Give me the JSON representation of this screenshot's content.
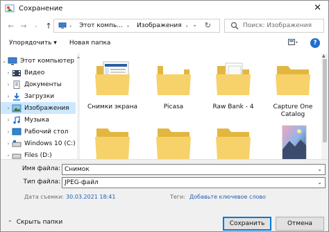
{
  "window": {
    "title": "Сохранение",
    "close": "✕"
  },
  "nav": {
    "address": [
      "Этот компь...",
      "Изображения"
    ],
    "search_placeholder": "Поиск: Изображения"
  },
  "toolbar": {
    "organize": "Упорядочить ▾",
    "new_folder": "Новая папка"
  },
  "sidebar": {
    "items": [
      {
        "label": "Этот компьютер",
        "icon": "computer-icon",
        "expand": "⌄"
      },
      {
        "label": "Видео",
        "icon": "video-folder-icon",
        "expand": "›"
      },
      {
        "label": "Документы",
        "icon": "documents-folder-icon",
        "expand": "›"
      },
      {
        "label": "Загрузки",
        "icon": "downloads-folder-icon",
        "expand": "›"
      },
      {
        "label": "Изображения",
        "icon": "pictures-folder-icon",
        "expand": "›",
        "selected": true
      },
      {
        "label": "Музыка",
        "icon": "music-folder-icon",
        "expand": "›"
      },
      {
        "label": "Рабочий стол",
        "icon": "desktop-folder-icon",
        "expand": "›"
      },
      {
        "label": "Windows 10 (C:)",
        "icon": "drive-icon",
        "expand": "›"
      },
      {
        "label": "Files (D:)",
        "icon": "drive-icon",
        "expand": "›"
      }
    ]
  },
  "folders": [
    {
      "label": "Снимки экрана",
      "icon": "screenshots-folder-icon"
    },
    {
      "label": "Picasa",
      "icon": "folder-icon"
    },
    {
      "label": "Raw Bank - 4",
      "icon": "folder-icon"
    },
    {
      "label": "Capture One Catalog",
      "icon": "folder-icon"
    },
    {
      "label": "",
      "icon": "folder-icon"
    },
    {
      "label": "",
      "icon": "folder-icon"
    },
    {
      "label": "",
      "icon": "folder-icon"
    },
    {
      "label": "",
      "icon": "image-thumbnail-icon"
    }
  ],
  "form": {
    "filename_label": "Имя файла:",
    "filename_value": "Снимок",
    "filetype_label": "Тип файла:",
    "filetype_value": "JPEG-файл",
    "date_label": "Дата съемки:",
    "date_value": "30.03.2021 18:41",
    "tags_label": "Теги:",
    "tags_value": "Добавьте ключевое слово"
  },
  "footer": {
    "hide_folders": "Скрыть папки",
    "save": "Сохранить",
    "cancel": "Отмена"
  },
  "colors": {
    "accent": "#0078d7",
    "selection": "#cce8ff",
    "link": "#1f5fb4",
    "folder": "#f7d26b"
  }
}
